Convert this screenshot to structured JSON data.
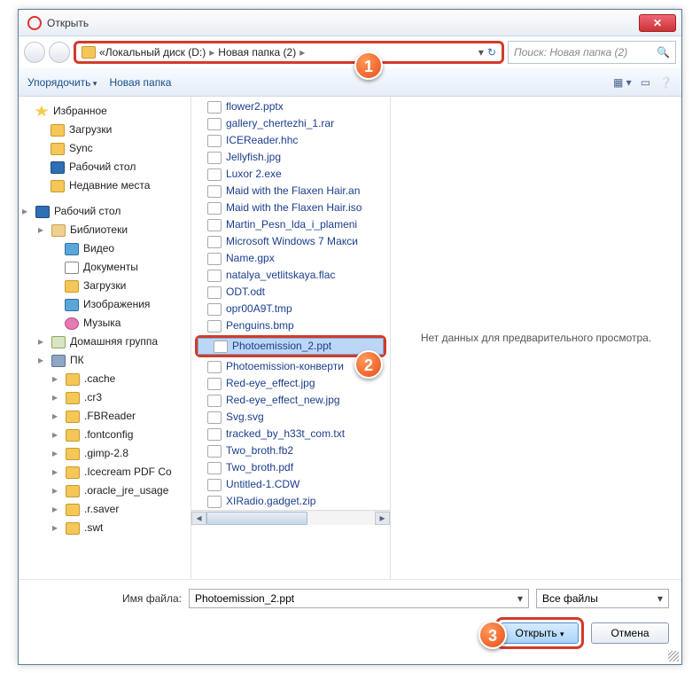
{
  "title": "Открыть",
  "breadcrumb": {
    "sep": "«",
    "p1": "Локальный диск (D:)",
    "p2": "Новая папка (2)"
  },
  "search_placeholder": "Поиск: Новая папка (2)",
  "toolbar": {
    "organize": "Упорядочить",
    "newfolder": "Новая папка"
  },
  "nav": {
    "fav": "Избранное",
    "fav_items": [
      "Загрузки",
      "Sync",
      "Рабочий стол",
      "Недавние места"
    ],
    "desktop": "Рабочий стол",
    "libs": "Библиотеки",
    "lib_items": [
      "Видео",
      "Документы",
      "Загрузки",
      "Изображения",
      "Музыка"
    ],
    "homegroup": "Домашняя группа",
    "pc": "ПК",
    "pc_items": [
      ".cache",
      ".cr3",
      ".FBReader",
      ".fontconfig",
      ".gimp-2.8",
      ".Icecream PDF Co",
      ".oracle_jre_usage",
      ".r.saver",
      ".swt"
    ]
  },
  "files": [
    "flower2.pptx",
    "gallery_chertezhi_1.rar",
    "ICEReader.hhc",
    "Jellyfish.jpg",
    "Luxor 2.exe",
    "Maid with the Flaxen Hair.an",
    "Maid with the Flaxen Hair.iso",
    "Martin_Pesn_lda_i_plameni",
    "Microsoft Windows 7 Макси",
    "Name.gpx",
    "natalya_vetlitskaya.flac",
    "ODT.odt",
    "opr00A9T.tmp",
    "Penguins.bmp",
    "Photoemission_2.ppt",
    "Photoemission-конверти",
    "Red-eye_effect.jpg",
    "Red-eye_effect_new.jpg",
    "Svg.svg",
    "tracked_by_h33t_com.txt",
    "Two_broth.fb2",
    "Two_broth.pdf",
    "Untitled-1.CDW",
    "XIRadio.gadget.zip"
  ],
  "selected_index": 14,
  "preview_empty": "Нет данных для предварительного просмотра.",
  "filename_label": "Имя файла:",
  "filename_value": "Photoemission_2.ppt",
  "filter": "Все файлы",
  "btn_open": "Открыть",
  "btn_cancel": "Отмена",
  "markers": {
    "m1": "1",
    "m2": "2",
    "m3": "3"
  }
}
